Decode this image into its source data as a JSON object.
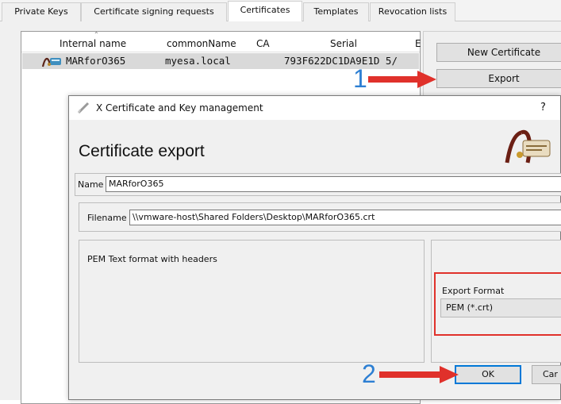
{
  "tabs": [
    {
      "label": "Private Keys"
    },
    {
      "label": "Certificate signing requests"
    },
    {
      "label": "Certificates"
    },
    {
      "label": "Templates"
    },
    {
      "label": "Revocation lists"
    }
  ],
  "active_tab": "Certificates",
  "cert_list": {
    "columns": [
      "Internal name",
      "commonName",
      "CA",
      "Serial",
      "E"
    ],
    "rows": [
      {
        "internal_name": "MARforO365",
        "common_name": "myesa.local",
        "ca": "",
        "serial": "793F622DC1DA9E1D 5/"
      }
    ]
  },
  "side_panel": {
    "new_certificate_label": "New Certificate",
    "export_label": "Export"
  },
  "annotations": {
    "step1": "1",
    "step2": "2",
    "arrow_color": "#e0312b",
    "number_color": "#2d7fd3"
  },
  "dialog": {
    "title": "X Certificate and Key management",
    "help": "?",
    "heading": "Certificate export",
    "name_label": "Name",
    "name_value": "MARforO365",
    "filename_label": "Filename",
    "filename_value": "\\\\vmware-host\\Shared Folders\\Desktop\\MARforO365.crt",
    "format_description": "PEM Text format with headers",
    "export_format_label": "Export Format",
    "export_format_value": "PEM (*.crt)",
    "ok_label": "OK",
    "cancel_label": "Car"
  },
  "colors": {
    "highlight_border": "#e0312b",
    "default_button_border": "#0078d7",
    "selected_row": "#d9d9d9"
  },
  "icons": [
    "certificate-row-icon",
    "pen-app-icon",
    "certificate-scroll-logo"
  ]
}
